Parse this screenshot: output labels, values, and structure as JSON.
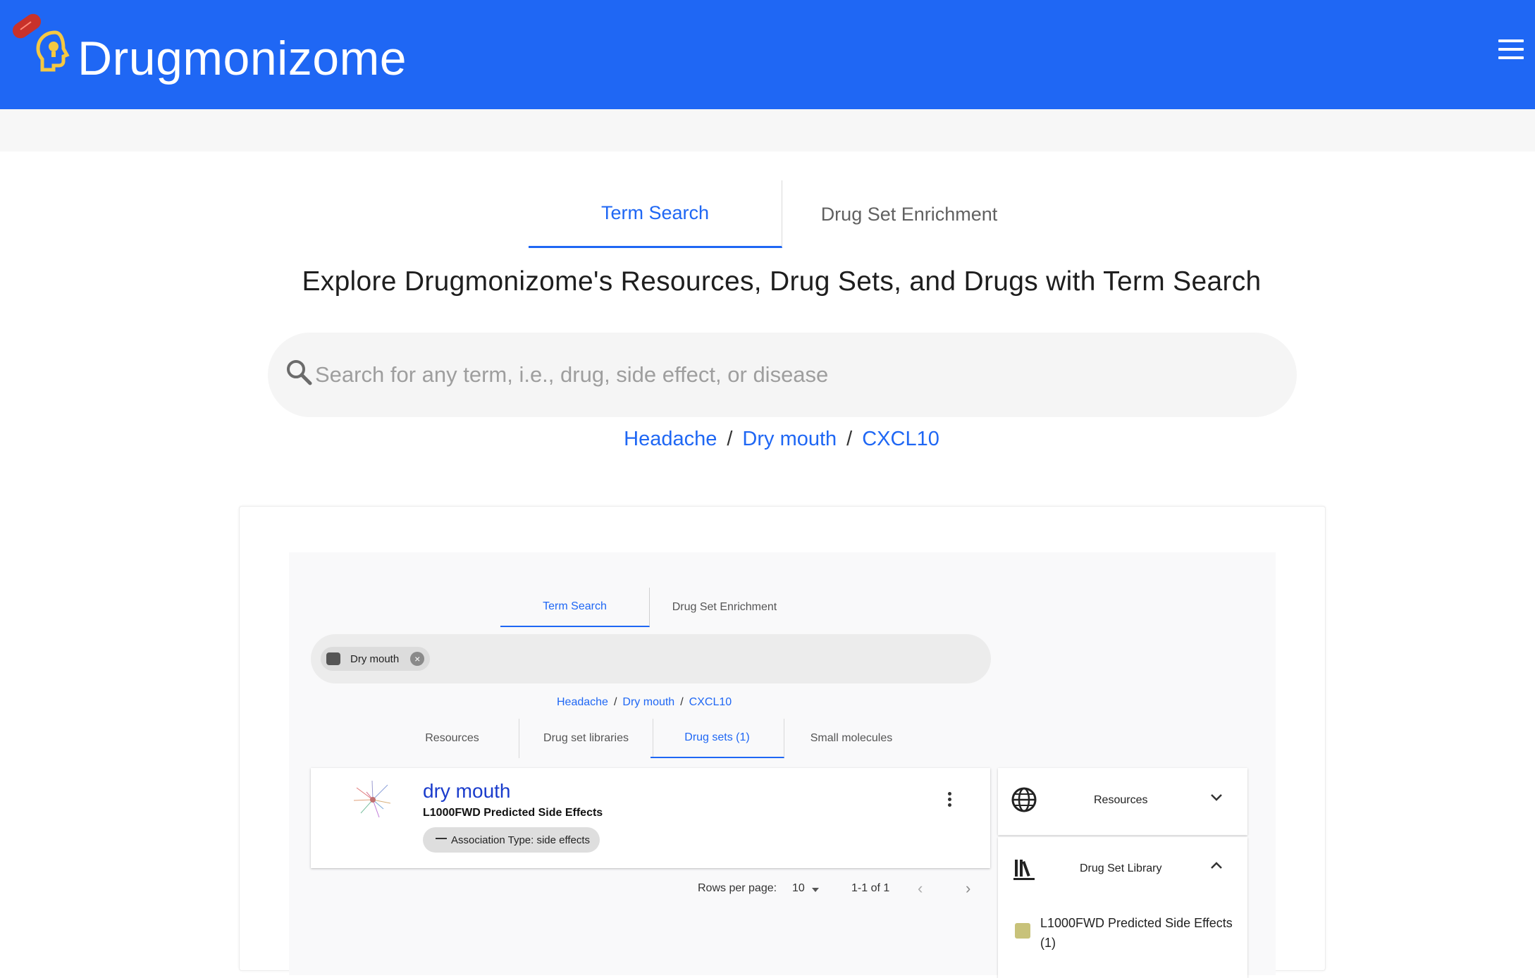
{
  "app": {
    "brand": "Drugmonizome",
    "accent": "#1f67f4"
  },
  "main_tabs": [
    {
      "label": "Term Search",
      "active": true
    },
    {
      "label": "Drug Set Enrichment",
      "active": false
    }
  ],
  "headline": "Explore Drugmonizome's Resources, Drug Sets, and Drugs with Term Search",
  "search": {
    "placeholder": "Search for any term, i.e., drug, side effect, or disease",
    "value": ""
  },
  "examples": [
    "Headache",
    "Dry mouth",
    "CXCL10"
  ],
  "separator": "/",
  "preview": {
    "tabs": [
      {
        "label": "Term Search",
        "active": true
      },
      {
        "label": "Drug Set Enrichment",
        "active": false
      }
    ],
    "chip": "Dry mouth",
    "examples": [
      "Headache",
      "Dry mouth",
      "CXCL10"
    ],
    "sub_tabs": [
      {
        "label": "Resources",
        "active": false
      },
      {
        "label": "Drug set libraries",
        "active": false
      },
      {
        "label": "Drug sets (1)",
        "active": true
      },
      {
        "label": "Small molecules",
        "active": false
      }
    ],
    "result": {
      "title": "dry mouth",
      "subtitle": "L1000FWD Predicted Side Effects",
      "pill": "Association Type: side effects"
    },
    "pagination": {
      "rows_label": "Rows per page:",
      "rows_value": "10",
      "range": "1-1 of 1"
    },
    "filters": [
      {
        "title": "Resources",
        "icon": "globe-icon",
        "expanded": false
      },
      {
        "title": "Drug Set Library",
        "icon": "library-icon",
        "expanded": true
      }
    ],
    "filter_option": {
      "label": "L1000FWD Predicted Side Effects (1)",
      "checked": true
    }
  }
}
